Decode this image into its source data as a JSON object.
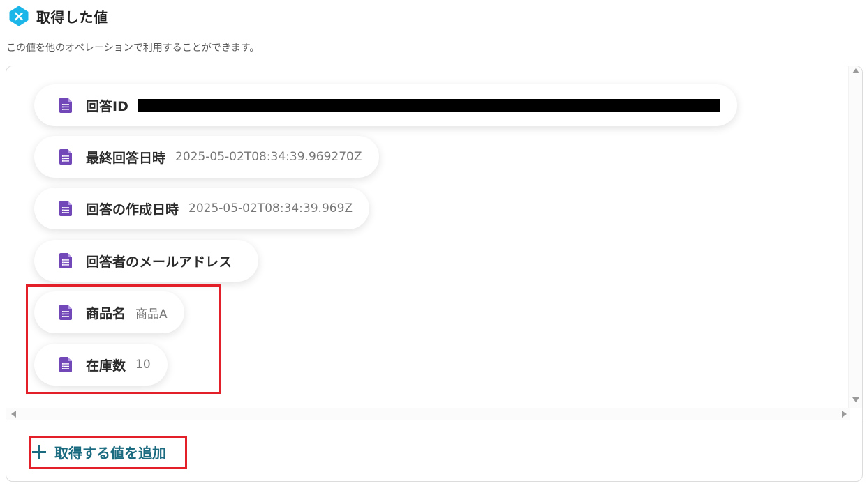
{
  "header": {
    "title": "取得した値",
    "logo_icon": "yoom-logo-icon"
  },
  "description": "この値を他のオペレーションで利用することができます。",
  "fields": [
    {
      "label": "回答ID",
      "value": "",
      "redacted": true,
      "icon": "google-forms-icon"
    },
    {
      "label": "最終回答日時",
      "value": "2025-05-02T08:34:39.969270Z",
      "icon": "google-forms-icon"
    },
    {
      "label": "回答の作成日時",
      "value": "2025-05-02T08:34:39.969Z",
      "icon": "google-forms-icon"
    },
    {
      "label": "回答者のメールアドレス",
      "value": "",
      "icon": "google-forms-icon"
    },
    {
      "label": "商品名",
      "value": "商品A",
      "icon": "google-forms-icon"
    },
    {
      "label": "在庫数",
      "value": "10",
      "icon": "google-forms-icon"
    }
  ],
  "add_button": {
    "label": "取得する値を追加",
    "icon": "plus-icon"
  },
  "colors": {
    "accent": "#1a6a80",
    "highlight": "#e3202a",
    "forms_purple": "#7248b9",
    "logo_blue": "#1db6e8"
  }
}
